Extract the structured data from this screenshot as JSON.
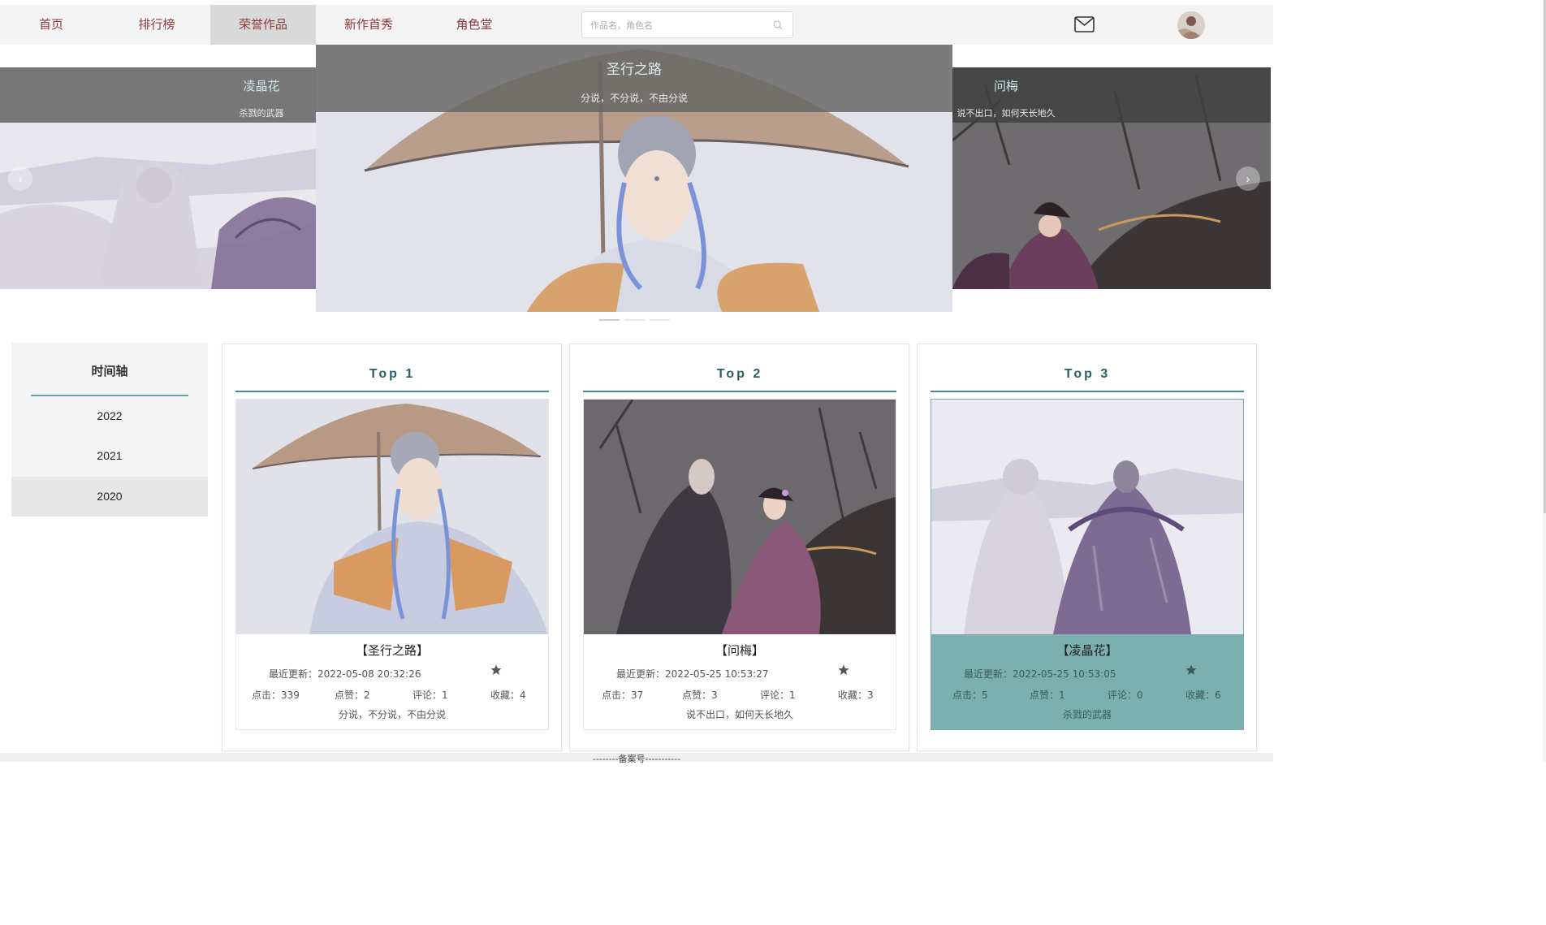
{
  "nav": {
    "items": [
      {
        "label": "首页"
      },
      {
        "label": "排行榜"
      },
      {
        "label": "荣誉作品"
      },
      {
        "label": "新作首秀"
      },
      {
        "label": "角色堂"
      }
    ],
    "active_index": 2,
    "search_placeholder": "作品名，角色名"
  },
  "carousel": {
    "left": {
      "title": "凌晶花",
      "subtitle": "杀戮的武器"
    },
    "center": {
      "title": "圣行之路",
      "subtitle": "分说，不分说，不由分说"
    },
    "right": {
      "title": "问梅",
      "subtitle": "说不出口，如何天长地久"
    },
    "prev_glyph": "‹",
    "next_glyph": "›"
  },
  "timeline": {
    "title": "时间轴",
    "years": [
      "2022",
      "2021",
      "2020"
    ],
    "active_index": 2
  },
  "cards": [
    {
      "rank": "Top 1",
      "name": "【圣行之路】",
      "update_label": "最近更新：",
      "update_time": "2022-05-08 20:32:26",
      "clicks": "点击：339",
      "likes": "点赞：2",
      "comments": "评论：1",
      "favorites": "收藏：4",
      "desc": "分说，不分说，不由分说"
    },
    {
      "rank": "Top 2",
      "name": "【问梅】",
      "update_label": "最近更新：",
      "update_time": "2022-05-25 10:53:27",
      "clicks": "点击：37",
      "likes": "点赞：3",
      "comments": "评论：1",
      "favorites": "收藏：3",
      "desc": "说不出口，如何天长地久"
    },
    {
      "rank": "Top 3",
      "name": "【凌晶花】",
      "update_label": "最近更新：",
      "update_time": "2022-05-25 10:53:05",
      "clicks": "点击：5",
      "likes": "点赞：1",
      "comments": "评论：0",
      "favorites": "收藏：6",
      "desc": "杀戮的武器"
    }
  ],
  "footer": {
    "text": "--------备案号-----------"
  },
  "colors": {
    "nav_text": "#8b3a3a",
    "accent_teal": "#4a8a8c",
    "highlight_card": "#7ab0b0",
    "caption_text": "#cfe9e8"
  },
  "icons": {
    "search": "search-icon",
    "mail": "mail-icon",
    "star": "star-icon",
    "prev": "chevron-left-icon",
    "next": "chevron-right-icon"
  }
}
